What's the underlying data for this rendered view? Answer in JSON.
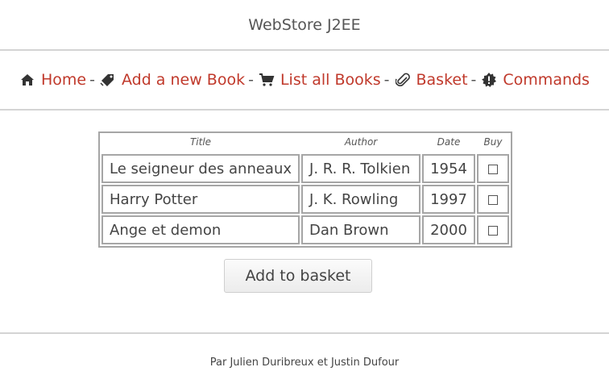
{
  "header": {
    "title": "WebStore J2EE"
  },
  "nav": {
    "items": [
      {
        "label": "Home",
        "icon": "home-icon"
      },
      {
        "label": "Add a new Book",
        "icon": "tag-icon"
      },
      {
        "label": "List all Books",
        "icon": "cart-icon"
      },
      {
        "label": "Basket",
        "icon": "paperclip-icon"
      },
      {
        "label": "Commands",
        "icon": "gear-badge-icon"
      }
    ],
    "separator": "-"
  },
  "table": {
    "headers": [
      "Title",
      "Author",
      "Date",
      "Buy"
    ],
    "rows": [
      {
        "title": "Le seigneur des anneaux",
        "author": "J. R. R. Tolkien",
        "date": "1954"
      },
      {
        "title": "Harry Potter",
        "author": "J. K. Rowling",
        "date": "1997"
      },
      {
        "title": "Ange et demon",
        "author": "Dan Brown",
        "date": "2000"
      }
    ]
  },
  "add_button": {
    "label": "Add to basket"
  },
  "footer": {
    "text": "Par Julien Duribreux et Justin Dufour"
  },
  "colors": {
    "link": "#c0392b",
    "rule": "#d4d4d4",
    "table_border": "#a6a6a6"
  }
}
